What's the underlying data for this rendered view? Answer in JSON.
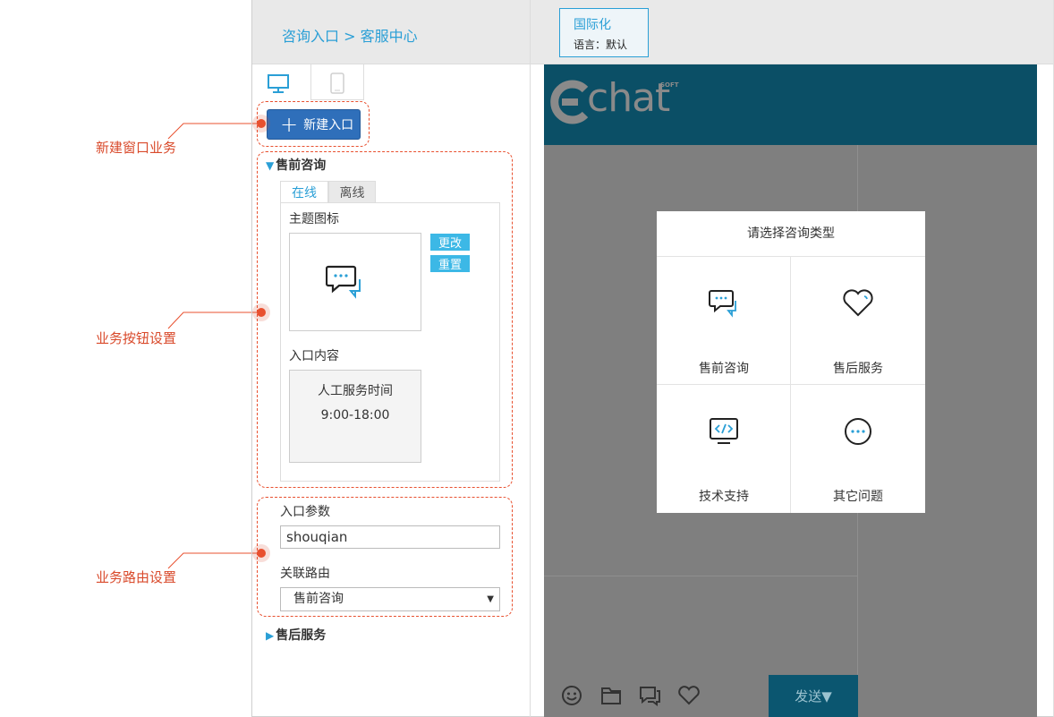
{
  "breadcrumb": "咨询入口 > 客服中心",
  "i18n": {
    "title": "国际化",
    "language": "语言：默认"
  },
  "new_entry_button": "新建入口",
  "annotations": {
    "new_window_business": "新建窗口业务",
    "business_button_settings": "业务按钮设置",
    "business_routing_settings": "业务路由设置"
  },
  "sections": {
    "presales": {
      "title": "售前咨询",
      "tabs": [
        "在线",
        "离线"
      ],
      "theme_icon_label": "主题图标",
      "change_button": "更改",
      "reset_button": "重置",
      "entry_content_label": "入口内容",
      "entry_content_lines": [
        "人工服务时间",
        "9:00-18:00"
      ]
    },
    "params": {
      "entry_param_label": "入口参数",
      "entry_param_value": "shouqian",
      "route_label": "关联路由",
      "route_value": "售前咨询"
    },
    "aftersales": {
      "title": "售后服务"
    }
  },
  "preview": {
    "logo": "chat",
    "logo_sup": "SOFT",
    "modal_title": "请选择咨询类型",
    "options": [
      {
        "label": "售前咨询",
        "icon": "chat-bubbles-icon"
      },
      {
        "label": "售后服务",
        "icon": "heart-icon"
      },
      {
        "label": "技术支持",
        "icon": "code-monitor-icon"
      },
      {
        "label": "其它问题",
        "icon": "more-circle-icon"
      }
    ],
    "send_button": "发送▼"
  },
  "colors": {
    "accent": "#2a9fd6",
    "annotation": "#e8502f",
    "header": "#0b4f66",
    "button": "#2f6fba"
  }
}
